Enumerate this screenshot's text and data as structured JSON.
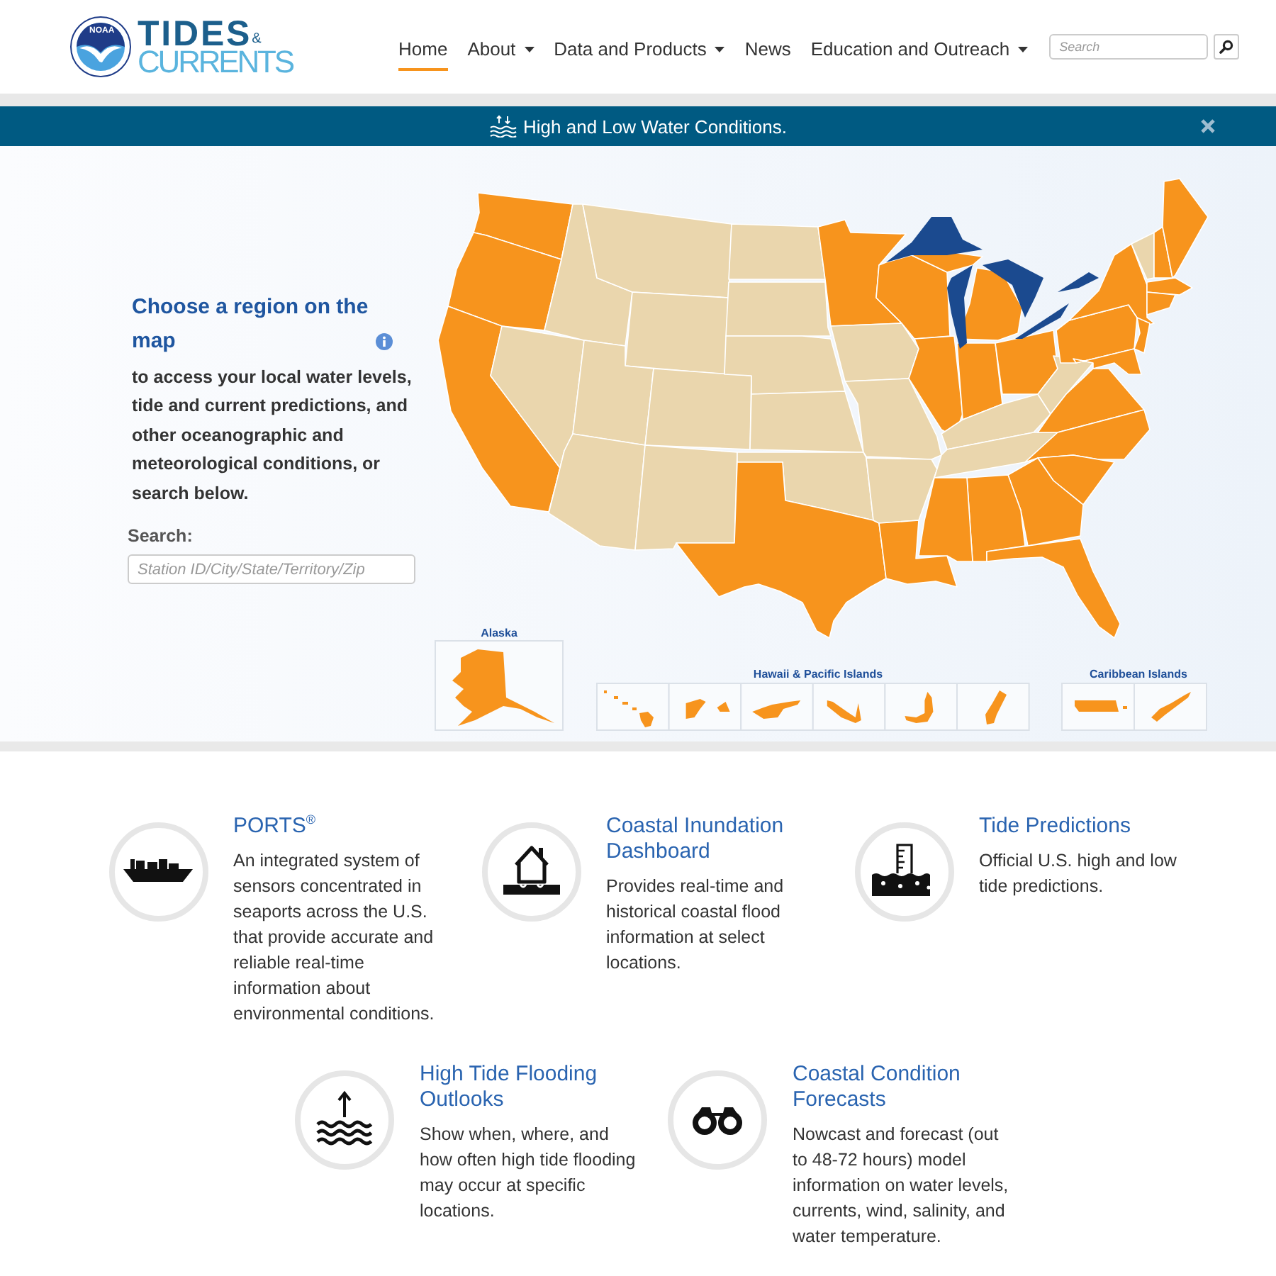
{
  "header": {
    "logo": {
      "emblem_text": "NOAA",
      "title": "TIDES",
      "ampersand": "&",
      "subtitle": "CURRENTS"
    },
    "nav": [
      {
        "label": "Home",
        "selected": true,
        "dropdown": false
      },
      {
        "label": "About",
        "selected": false,
        "dropdown": true
      },
      {
        "label": "Data and Products",
        "selected": false,
        "dropdown": true
      },
      {
        "label": "News",
        "selected": false,
        "dropdown": false
      },
      {
        "label": "Education and Outreach",
        "selected": false,
        "dropdown": true
      }
    ],
    "search": {
      "placeholder": "Search"
    }
  },
  "banner": {
    "text": "High and Low Water Conditions."
  },
  "hero": {
    "heading": "Choose a region on the map",
    "description": "to access your local water levels, tide and current predictions, and other oceanographic and meteorological conditions, or search below.",
    "search_label": "Search:",
    "search_placeholder": "Station ID/City/State/Territory/Zip",
    "map_insets": [
      {
        "label": "Alaska"
      },
      {
        "label": "Hawaii & Pacific Islands"
      },
      {
        "label": "Caribbean Islands"
      }
    ]
  },
  "features": [
    {
      "kind": "ship",
      "title": "PORTS$^{®}$",
      "description": "An integrated system of sensors concentrated in seaports across the U.S. that provide accurate and reliable real-time information about environmental conditions."
    },
    {
      "kind": "house",
      "title": "Coastal Inundation Dashboard",
      "description": "Provides real-time and historical coastal flood information at select locations."
    },
    {
      "kind": "tide_gauge",
      "title": "Tide Predictions",
      "description": "Official U.S. high and low tide predictions."
    },
    {
      "kind": "waves",
      "title": "High Tide Flooding Outlooks",
      "description": "Show when, where, and how often high tide flooding may occur at specific locations."
    },
    {
      "kind": "binoculars",
      "title": "Coastal Condition Forecasts",
      "description": "Nowcast and forecast (out to 48-72 hours) model information on water levels, currents, wind, salinity, and water temperature."
    }
  ]
}
